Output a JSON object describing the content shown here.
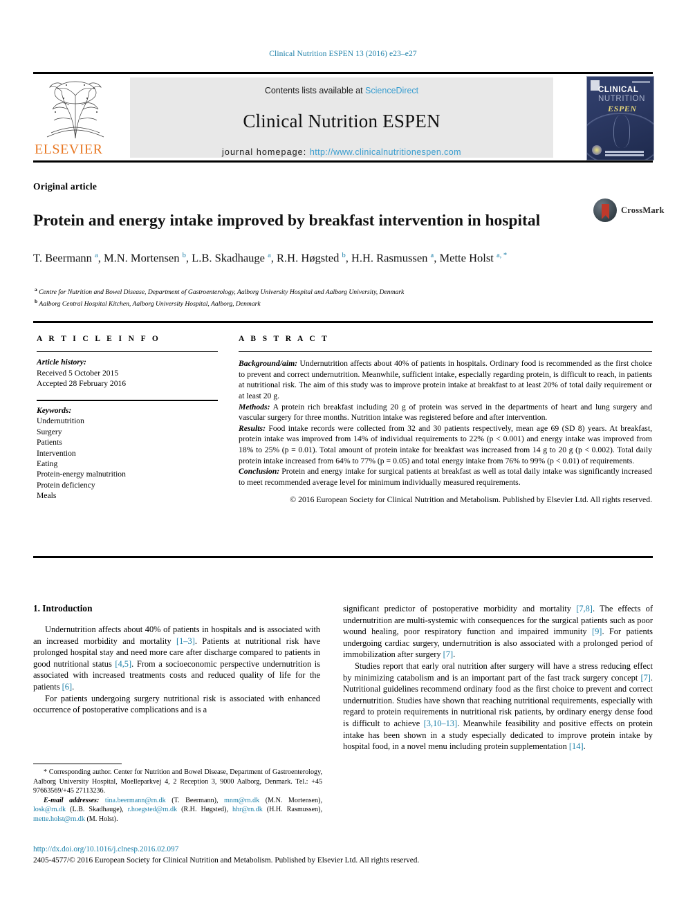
{
  "running_head": "Clinical Nutrition ESPEN 13 (2016) e23–e27",
  "masthead": {
    "publisher_name": "ELSEVIER",
    "contents_prefix": "Contents lists available at ",
    "contents_link": "ScienceDirect",
    "journal_name": "Clinical Nutrition ESPEN",
    "homepage_label": "journal homepage: ",
    "homepage_url": "http://www.clinicalnutritionespen.com",
    "cover": {
      "line1": "CLINICAL",
      "line2": "NUTRITION",
      "line3": "ESPEN"
    }
  },
  "article": {
    "type": "Original article",
    "title": "Protein and energy intake improved by breakfast intervention in hospital",
    "crossmark_label": "CrossMark",
    "authors_html": "T. Beermann <sup>a</sup>, M.N. Mortensen <sup>b</sup>, L.B. Skadhauge <sup>a</sup>, R.H. Høgsted <sup>b</sup>, H.H. Rasmussen <sup>a</sup>, Mette Holst <sup>a, *</sup>",
    "affiliations": [
      "Centre for Nutrition and Bowel Disease, Department of Gastroenterology, Aalborg University Hospital and Aalborg University, Denmark",
      "Aalborg Central Hospital Kitchen, Aalborg University Hospital, Aalborg, Denmark"
    ]
  },
  "article_info": {
    "heading": "A R T I C L E  I N F O",
    "history_label": "Article history:",
    "history": [
      "Received 5 October 2015",
      "Accepted 28 February 2016"
    ],
    "keywords_label": "Keywords:",
    "keywords": [
      "Undernutrition",
      "Surgery",
      "Patients",
      "Intervention",
      "Eating",
      "Protein-energy malnutrition",
      "Protein deficiency",
      "Meals"
    ]
  },
  "abstract": {
    "heading": "A B S T R A C T",
    "sections": [
      {
        "label": "Background/aim:",
        "text": " Undernutrition affects about 40% of patients in hospitals. Ordinary food is recommended as the first choice to prevent and correct undernutrition. Meanwhile, sufficient intake, especially regarding protein, is difficult to reach, in patients at nutritional risk. The aim of this study was to improve protein intake at breakfast to at least 20% of total daily requirement or at least 20 g."
      },
      {
        "label": "Methods:",
        "text": " A protein rich breakfast including 20 g of protein was served in the departments of heart and lung surgery and vascular surgery for three months. Nutrition intake was registered before and after intervention."
      },
      {
        "label": "Results:",
        "text": " Food intake records were collected from 32 and 30 patients respectively, mean age 69 (SD 8) years. At breakfast, protein intake was improved from 14% of individual requirements to 22% (p < 0.001) and energy intake was improved from 18% to 25% (p = 0.01). Total amount of protein intake for breakfast was increased from 14 g to 20 g (p < 0.002). Total daily protein intake increased from 64% to 77% (p = 0.05) and total energy intake from 76% to 99% (p < 0.01) of requirements."
      },
      {
        "label": "Conclusion:",
        "text": " Protein and energy intake for surgical patients at breakfast as well as total daily intake was significantly increased to meet recommended average level for minimum individually measured requirements."
      }
    ],
    "copyright": "© 2016 European Society for Clinical Nutrition and Metabolism. Published by Elsevier Ltd. All rights reserved."
  },
  "body": {
    "section_heading": "1. Introduction",
    "left_paragraphs": [
      "Undernutrition affects about 40% of patients in hospitals and is associated with an increased morbidity and mortality [1–3]. Patients at nutritional risk have prolonged hospital stay and need more care after discharge compared to patients in good nutritional status [4,5]. From a socioeconomic perspective undernutrition is associated with increased treatments costs and reduced quality of life for the patients [6].",
      "For patients undergoing surgery nutritional risk is associated with enhanced occurrence of postoperative complications and is a"
    ],
    "right_paragraphs": [
      "significant predictor of postoperative morbidity and mortality [7,8]. The effects of undernutrition are multi-systemic with consequences for the surgical patients such as poor wound healing, poor respiratory function and impaired immunity [9]. For patients undergoing cardiac surgery, undernutrition is also associated with a prolonged period of immobilization after surgery [7].",
      "Studies report that early oral nutrition after surgery will have a stress reducing effect by minimizing catabolism and is an important part of the fast track surgery concept [7]. Nutritional guidelines recommend ordinary food as the first choice to prevent and correct undernutrition. Studies have shown that reaching nutritional requirements, especially with regard to protein requirements in nutritional risk patients, by ordinary energy dense food is difficult to achieve [3,10–13]. Meanwhile feasibility and positive effects on protein intake has been shown in a study especially dedicated to improve protein intake by hospital food, in a novel menu including protein supplementation [14]."
    ]
  },
  "footnotes": {
    "corresponding": "* Corresponding author. Center for Nutrition and Bowel Disease, Department of Gastroenterology, Aalborg University Hospital, Moelleparkvej 4, 2 Reception 3, 9000 Aalborg, Denmark. Tel.: +45 97663569/+45 27113236.",
    "email_label": "E-mail addresses:",
    "emails": [
      {
        "address": "tina.beermann@rn.dk",
        "person": "(T. Beermann)"
      },
      {
        "address": "mnm@rn.dk",
        "person": "(M.N. Mortensen)"
      },
      {
        "address": "losk@rn.dk",
        "person": "(L.B. Skadhauge)"
      },
      {
        "address": "r.hoegsted@rn.dk",
        "person": "(R.H. Høgsted)"
      },
      {
        "address": "hhr@rn.dk",
        "person": "(H.H. Rasmussen)"
      },
      {
        "address": "mette.holst@rn.dk",
        "person": "(M. Holst)"
      }
    ]
  },
  "publication_footer": {
    "doi": "http://dx.doi.org/10.1016/j.clnesp.2016.02.097",
    "issn_copyright": "2405-4577/© 2016 European Society for Clinical Nutrition and Metabolism. Published by Elsevier Ltd. All rights reserved."
  }
}
